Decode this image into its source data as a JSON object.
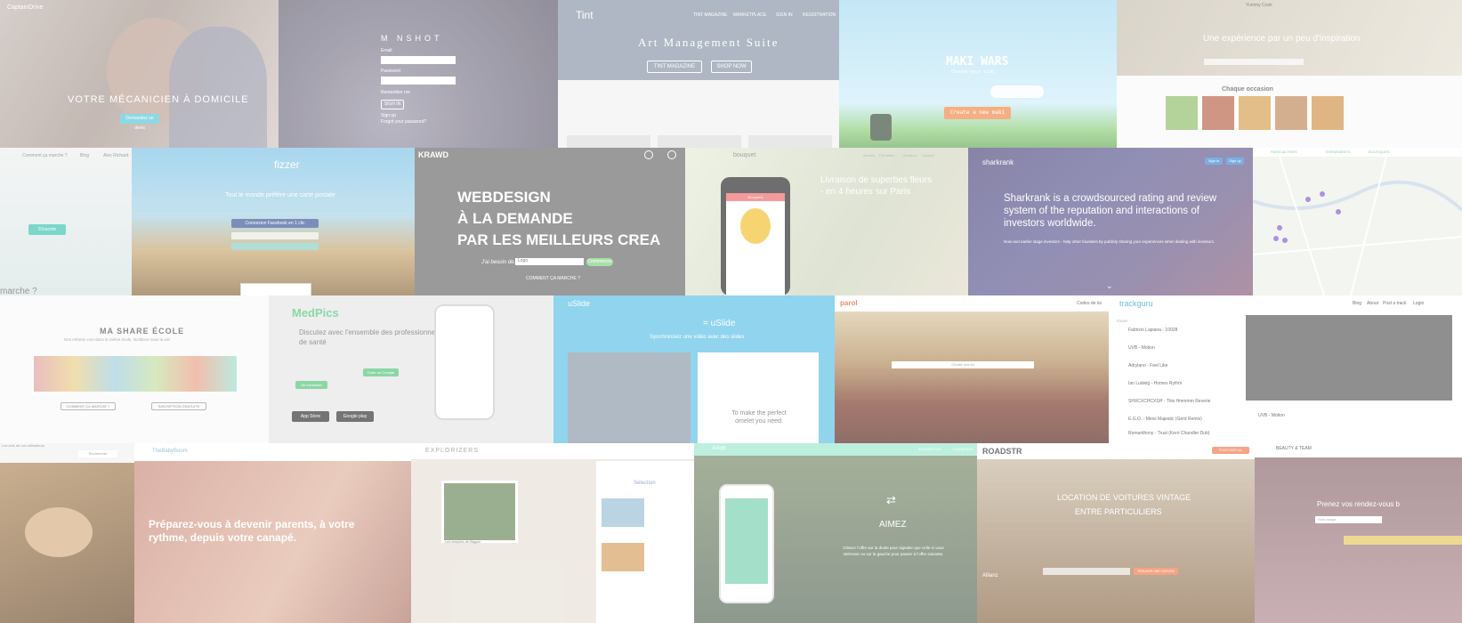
{
  "row1": {
    "captaindrive": {
      "logo": "CaptainDrive",
      "headline": "VOTRE MÉCANICIEN À DOMICILE",
      "cta": "Demandez un devis"
    },
    "moonshot": {
      "logo": "M  NSHOT",
      "email_label": "Email",
      "password_label": "Password",
      "remember": "Remember me",
      "signin": "SIGN IN",
      "signup": "Sign up",
      "forgot": "Forgot your password?"
    },
    "tint": {
      "logo": "Tint",
      "nav": [
        "TINT MAGAZINE",
        "MARKETPLACE",
        "SIGN IN",
        "REGISTRATION"
      ],
      "title": "Art Management Suite",
      "btn1": "TINT MAGAZINE",
      "btn2": "SHOP NOW"
    },
    "makiwars": {
      "title": "MAKI WARS",
      "subtitle": "Choose your side.",
      "cta": "Create a new maki"
    },
    "yummy": {
      "logo": "Yummy Cook",
      "headline": "Une expérience par un peu d'inspiration",
      "section": "Chaque occasion"
    }
  },
  "row2": {
    "marche": {
      "nav": [
        "Comment ça marche ?",
        "Blog",
        "Alex Richard"
      ],
      "btn": "S'inscrire",
      "bottom": "marche ?"
    },
    "fizzer": {
      "logo": "fizzer",
      "tagline": "Tout le monde préfère une carte postale",
      "fb": "Connexion Facebook en 1 clic"
    },
    "krawd": {
      "logo": "KRAWD",
      "line1": "WEBDESIGN",
      "line2": "À LA DEMANDE",
      "line3": "PAR LES MEILLEURS CREA",
      "prompt": "J'ai besoin de...",
      "select": "Logo",
      "go": "Commencer",
      "how": "COMMENT ÇA MARCHE ?"
    },
    "bouquet": {
      "logo": "bouquet",
      "nav": [
        "Accueil",
        "Fleuristes",
        "Livraison",
        "Contact"
      ],
      "headline": "Livraison de superbes fleurs - en 4 heures sur Paris",
      "app_header": "Bouquets"
    },
    "sharkrank": {
      "logo": "sharkrank",
      "signin": "Sign in",
      "signup": "Sign up",
      "headline": "Sharkrank is a crowdsourced rating and review system of the reputation and interactions of investors worldwide.",
      "sub": "Now and earlier stage investors - help other founders by publicly sharing your experiences when dealing with investors."
    },
    "mapapp": {
      "logo": "PARIS ACTIVES",
      "links": [
        "ÉVÈNEMENTS",
        "BOUTIQUES"
      ]
    }
  },
  "row3": {
    "share": {
      "title": "MA SHARE ÉCOLE",
      "subtitle": "Nos enfants vont dans la même école, facilitons nous la vie!",
      "btn1": "COMMENT ÇA MARCHE ?",
      "btn2": "INSCRIPTION GRATUITE"
    },
    "medpics": {
      "logo": "MedPics",
      "headline": "Discutez avec l'ensemble des professionnels de santé",
      "btn": "Créer un Compte",
      "connect": "Se connecter",
      "appstore": "App Store",
      "googleplay": "Google play"
    },
    "uslide": {
      "logo": "uSlide",
      "formula": "= uSlide",
      "sub": "Synchronisez une vidéo avec des slides",
      "slide_text": "To make the perfect omelet you need:"
    },
    "parol": {
      "logo": "parol",
      "right": "Codes de loi",
      "choose": "Choisir une loi"
    },
    "trackguru": {
      "logo": "trackguru",
      "nav": [
        "Blog",
        "About",
        "Post a track",
        "Login"
      ],
      "today": "TODAY",
      "tracks": [
        "Fabrizio Lapiana - 10028",
        "UVB - Motion",
        "Adrylano - Feel Like",
        "Ian Ludwig - Homes Rythm",
        "SHXCXCHCXSH - This Hmmmm Reverie",
        "E.G.O. - Mess Majestic (Gerd Remix)",
        "Romanthony - Trust (Kerri Chandler Dub)"
      ],
      "playing": "UVB - Motion"
    }
  },
  "row4": {
    "left": {
      "tagline": "Les avis de nos utilisateurs",
      "btn": "Rechercher"
    },
    "babyboom": {
      "logo": "TheBabyBoom",
      "headline": "Préparez-vous à devenir parents, à votre rythme, depuis votre canapé."
    },
    "explorizers": {
      "logo": "EXPLORIZERS",
      "selection": "Sélection",
      "caption": "Les temples de Bagan"
    },
    "aimez": {
      "logo": "Adopt",
      "nav": [
        "INSCRIPTION",
        "CONNEXION"
      ],
      "title": "AIMEZ",
      "text": "Glissez l'offre sur la droite pour signaler que celle-ci vous intéresse ou sur la gauche pour passer à l'offre suivante."
    },
    "roadsta": {
      "logo": "ROADSTR",
      "btn": "PROPOSER MA VOITURE",
      "headline1": "LOCATION DE VOITURES VINTAGE",
      "headline2": "ENTRE PARTICULIERS",
      "search": "TROUVER UNE VOITURE",
      "partner": "Allianz"
    },
    "beauty": {
      "logo": "BEAUTY & TEAM",
      "text": "Prenez vos rendez-vous b",
      "field": "Soin visage"
    }
  },
  "colors": {
    "krawd_green": "#7ed17e",
    "tint_slate": "#8a95a8",
    "sharkrank_purple": "#4f4a7e",
    "uslide_blue": "#5cc0e6",
    "aimez_mint": "#9ee8d0",
    "yummy_green": "#8fbf6a"
  }
}
